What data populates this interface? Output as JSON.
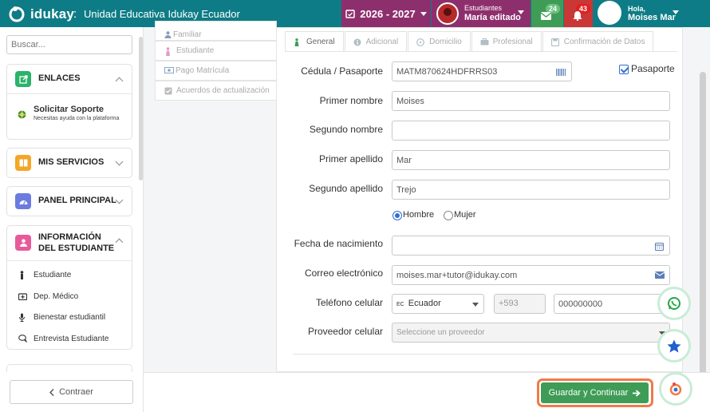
{
  "header": {
    "brand": "idukay",
    "separator": ":",
    "school": "Unidad Educativa Idukay Ecuador",
    "year": "2026 - 2027",
    "role_label": "Estudiantes",
    "role_name": "María editado",
    "mail_count": "24",
    "notif_count": "43",
    "greeting": "Hola,",
    "user_name": "Moises Mar"
  },
  "sidebar": {
    "search_placeholder": "Buscar...",
    "enlaces": {
      "title": "ENLACES",
      "support_title": "Solicitar Soporte",
      "support_sub": "Necesitas ayuda con la plataforma"
    },
    "servicios": {
      "title": "MIS SERVICIOS"
    },
    "panel": {
      "title": "PANEL PRINCIPAL"
    },
    "info": {
      "title": "INFORMACIÓN DEL ESTUDIANTE",
      "items": [
        "Estudiante",
        "Dep. Médico",
        "Bienestar estudiantil",
        "Entrevista Estudiante"
      ]
    },
    "back_label": "Contraer"
  },
  "steps": [
    "Familiar",
    "Estudiante",
    "Pago Matrícula",
    "Acuerdos de actualización"
  ],
  "tabs": [
    "General",
    "Adicional",
    "Domicilio",
    "Profesional",
    "Confirmación de Datos"
  ],
  "form": {
    "cedula_label": "Cédula / Pasaporte",
    "cedula_value": "MATM870624HDFRRS03",
    "pasaporte_label": "Pasaporte",
    "primer_nombre_label": "Primer nombre",
    "primer_nombre_value": "Moises",
    "segundo_nombre_label": "Segundo nombre",
    "segundo_nombre_value": "",
    "primer_apellido_label": "Primer apellido",
    "primer_apellido_value": "Mar",
    "segundo_apellido_label": "Segundo apellido",
    "segundo_apellido_value": "Trejo",
    "gender_male": "Hombre",
    "gender_female": "Mujer",
    "fecha_label": "Fecha de nacimiento",
    "fecha_value": "",
    "correo_label": "Correo electrónico",
    "correo_value": "moises.mar+tutor@idukay.com",
    "telefono_label": "Teléfono celular",
    "country_code": "EC",
    "country_name": "Ecuador",
    "dial_code": "+593",
    "phone_value": "000000000",
    "proveedor_label": "Proveedor celular",
    "proveedor_placeholder": "Seleccione un proveedor"
  },
  "actions": {
    "save_label": "Guardar y Continuar"
  },
  "colors": {
    "topbar": "#0e7c86",
    "year_bg": "#8e2f6d",
    "mail_bg": "#3f9c56",
    "bell_bg": "#c93737",
    "save_bg": "#3f9c56",
    "save_outline": "#f07b46"
  }
}
